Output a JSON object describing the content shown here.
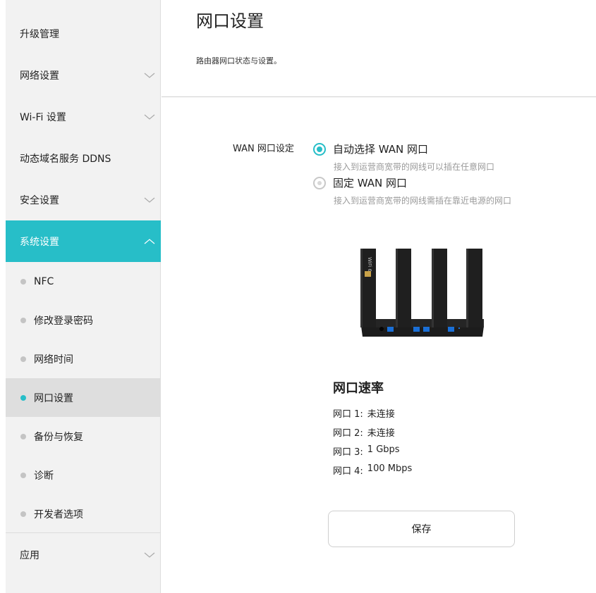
{
  "sidebar": {
    "items": [
      {
        "label": "升级管理",
        "has_chevron": false
      },
      {
        "label": "网络设置",
        "has_chevron": true
      },
      {
        "label": "Wi-Fi 设置",
        "has_chevron": true
      },
      {
        "label": "动态域名服务 DDNS",
        "has_chevron": false
      },
      {
        "label": "安全设置",
        "has_chevron": true
      },
      {
        "label": "系统设置",
        "has_chevron": true,
        "expanded": true,
        "active": true
      }
    ],
    "sub_items": [
      {
        "label": "NFC"
      },
      {
        "label": "修改登录密码"
      },
      {
        "label": "网络时间"
      },
      {
        "label": "网口设置",
        "selected": true
      },
      {
        "label": "备份与恢复"
      },
      {
        "label": "诊断"
      },
      {
        "label": "开发者选项"
      }
    ],
    "bottom_item": {
      "label": "应用",
      "has_chevron": true
    }
  },
  "header": {
    "title": "网口设置",
    "subtitle": "路由器网口状态与设置。"
  },
  "wan": {
    "label": "WAN 网口设定",
    "options": [
      {
        "label": "自动选择 WAN 网口",
        "desc": "接入到运营商宽带的网线可以插在任意网口",
        "checked": true
      },
      {
        "label": "固定 WAN 网口",
        "desc": "接入到运营商宽带的网线需插在靠近电源的网口",
        "checked": false
      }
    ]
  },
  "router_image": {
    "logo_text": "WiFi 6"
  },
  "port_rates": {
    "title": "网口速率",
    "ports": [
      {
        "label": "网口 1:",
        "value": "未连接"
      },
      {
        "label": "网口 2:",
        "value": "未连接"
      },
      {
        "label": "网口 3:",
        "value": "1 Gbps"
      },
      {
        "label": "网口 4:",
        "value": "100 Mbps"
      }
    ]
  },
  "save_button": {
    "label": "保存"
  },
  "colors": {
    "accent": "#27bec8",
    "port_blue": "#1a6fd6"
  }
}
